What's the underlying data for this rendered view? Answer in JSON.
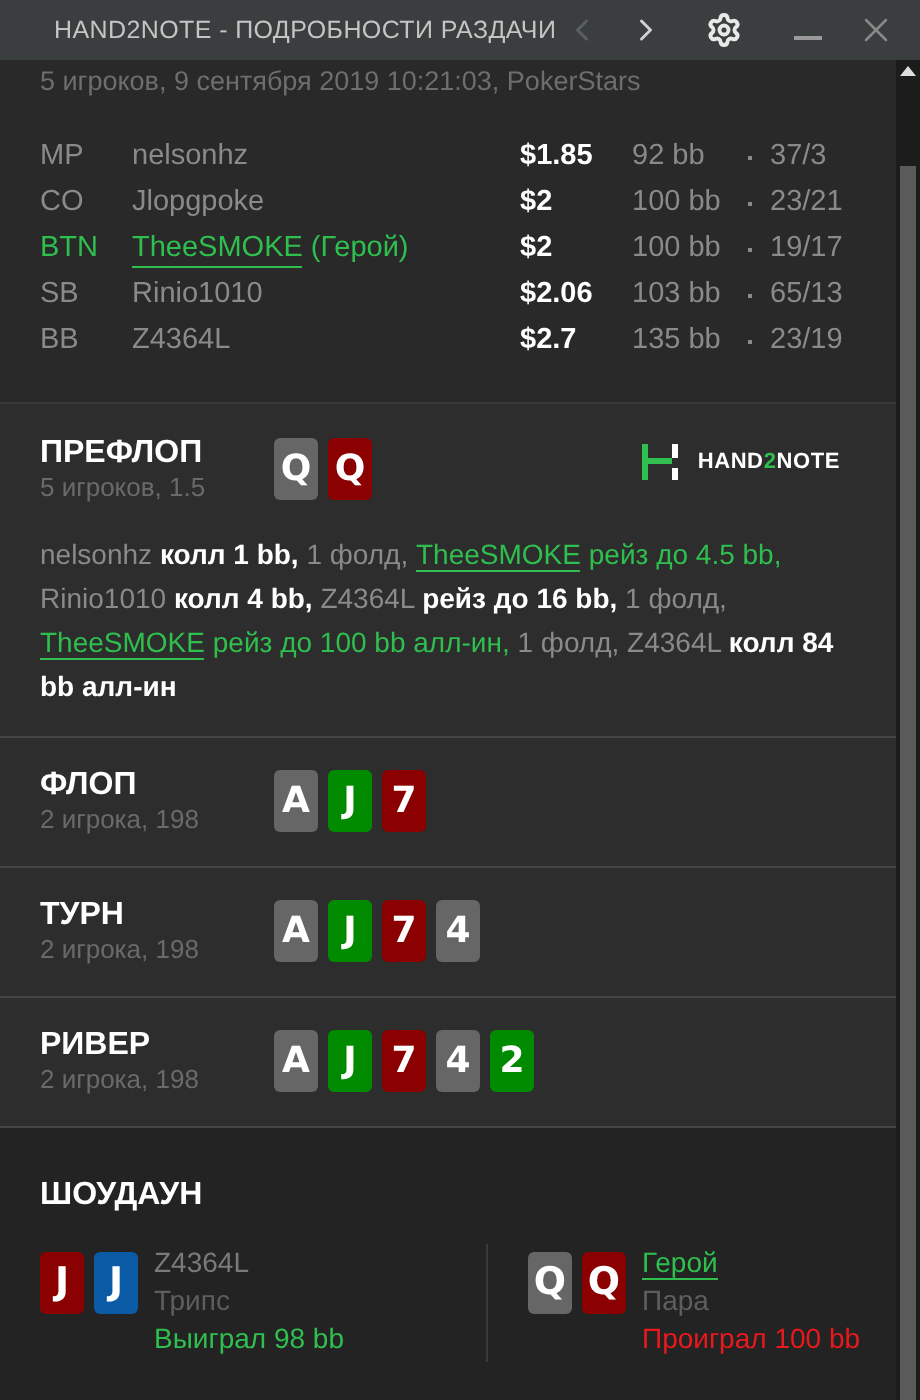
{
  "window": {
    "title": "HAND2NOTE - ПОДРОБНОСТИ РАЗДАЧИ",
    "prev_disabled": true
  },
  "info": "5 игроков, 9 сентября 2019 10:21:03, PokerStars",
  "players": [
    {
      "position": "MP",
      "name": "nelsonhz",
      "hero": false,
      "stack": "$1.85",
      "bb": "92 bb",
      "stats": "37/3"
    },
    {
      "position": "CO",
      "name": "Jlopgpoke",
      "hero": false,
      "stack": "$2",
      "bb": "100 bb",
      "stats": "23/21"
    },
    {
      "position": "BTN",
      "name": "TheeSMOKE",
      "hero": true,
      "hero_label": "(Герой)",
      "stack": "$2",
      "bb": "100 bb",
      "stats": "19/17"
    },
    {
      "position": "SB",
      "name": "Rinio1010",
      "hero": false,
      "stack": "$2.06",
      "bb": "103 bb",
      "stats": "65/13"
    },
    {
      "position": "BB",
      "name": "Z4364L",
      "hero": false,
      "stack": "$2.7",
      "bb": "135 bb",
      "stats": "23/19"
    }
  ],
  "streets": [
    {
      "title": "ПРЕФЛОП",
      "sub": "5 игроков, 1.5",
      "cards": [
        {
          "rank": "Q",
          "color": "#666666"
        },
        {
          "rank": "Q",
          "color": "#8b0000"
        }
      ],
      "logo": [
        {
          "text": "HAND",
          "accent": false
        },
        {
          "text": "2",
          "accent": true
        },
        {
          "text": "NOTE",
          "accent": false
        }
      ],
      "actions": [
        {
          "text": "nelsonhz",
          "kind": "player"
        },
        {
          "text": "колл 1 bb,",
          "kind": "action"
        },
        {
          "text": "1 фолд,",
          "kind": "fold"
        },
        {
          "text": "TheeSMOKE",
          "kind": "hero"
        },
        {
          "text": "рейз до 4.5 bb,",
          "kind": "hero_action"
        },
        {
          "text": "Rinio1010",
          "kind": "player"
        },
        {
          "text": "колл 4 bb,",
          "kind": "action"
        },
        {
          "text": "Z4364L",
          "kind": "player"
        },
        {
          "text": "рейз до 16 bb,",
          "kind": "action"
        },
        {
          "text": "1 фолд,",
          "kind": "fold"
        },
        {
          "text": "TheeSMOKE",
          "kind": "hero"
        },
        {
          "text": "рейз до 100 bb алл-ин,",
          "kind": "hero_action"
        },
        {
          "text": "1 фолд,",
          "kind": "fold"
        },
        {
          "text": "Z4364L",
          "kind": "player"
        },
        {
          "text": "колл 84 bb алл-ин",
          "kind": "action"
        }
      ]
    },
    {
      "title": "ФЛОП",
      "sub": "2 игрока, 198",
      "cards": [
        {
          "rank": "A",
          "color": "#666666"
        },
        {
          "rank": "J",
          "color": "#008a00"
        },
        {
          "rank": "7",
          "color": "#8b0000"
        }
      ]
    },
    {
      "title": "ТУРН",
      "sub": "2 игрока, 198",
      "cards": [
        {
          "rank": "A",
          "color": "#666666"
        },
        {
          "rank": "J",
          "color": "#008a00"
        },
        {
          "rank": "7",
          "color": "#8b0000"
        },
        {
          "rank": "4",
          "color": "#666666"
        }
      ]
    },
    {
      "title": "РИВЕР",
      "sub": "2 игрока, 198",
      "cards": [
        {
          "rank": "A",
          "color": "#666666"
        },
        {
          "rank": "J",
          "color": "#008a00"
        },
        {
          "rank": "7",
          "color": "#8b0000"
        },
        {
          "rank": "4",
          "color": "#666666"
        },
        {
          "rank": "2",
          "color": "#008a00"
        }
      ]
    }
  ],
  "showdown": {
    "title": "ШОУДАУН",
    "players": [
      {
        "name": "Z4364L",
        "hero": false,
        "hand": "Трипс",
        "result": "Выиграл 98 bb",
        "won": true,
        "cards": [
          {
            "rank": "J",
            "color": "#8b0000"
          },
          {
            "rank": "J",
            "color": "#0b5aa6"
          }
        ]
      },
      {
        "name": "Герой",
        "hero": true,
        "hand": "Пара",
        "result": "Проиграл 100 bb",
        "won": false,
        "cards": [
          {
            "rank": "Q",
            "color": "#666666"
          },
          {
            "rank": "Q",
            "color": "#8b0000"
          }
        ]
      }
    ]
  }
}
